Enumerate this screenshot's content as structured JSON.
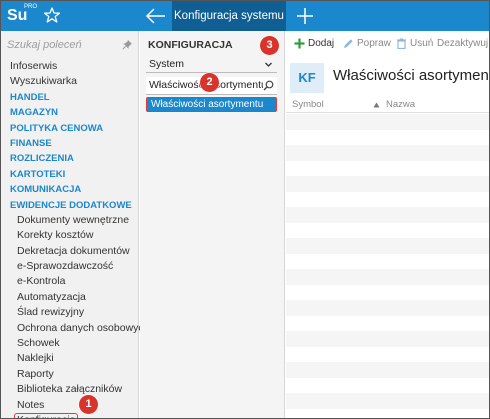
{
  "app": {
    "logo_text": "Su",
    "logo_sup": "PRO",
    "active_tab": "Konfiguracja systemu"
  },
  "sidebar": {
    "search_placeholder": "Szukaj poleceń",
    "items": [
      {
        "label": "Infoserwis",
        "type": "item"
      },
      {
        "label": "Wyszukiwarka",
        "type": "item"
      },
      {
        "label": "HANDEL",
        "type": "category"
      },
      {
        "label": "MAGAZYN",
        "type": "category"
      },
      {
        "label": "POLITYKA CENOWA",
        "type": "category"
      },
      {
        "label": "FINANSE",
        "type": "category"
      },
      {
        "label": "ROZLICZENIA",
        "type": "category"
      },
      {
        "label": "KARTOTEKI",
        "type": "category"
      },
      {
        "label": "KOMUNIKACJA",
        "type": "category"
      },
      {
        "label": "EWIDENCJE DODATKOWE",
        "type": "category"
      },
      {
        "label": "Dokumenty wewnętrzne",
        "type": "sub"
      },
      {
        "label": "Korekty kosztów",
        "type": "sub"
      },
      {
        "label": "Dekretacja dokumentów",
        "type": "sub"
      },
      {
        "label": "e-Sprawozdawczość",
        "type": "sub"
      },
      {
        "label": "e-Kontrola",
        "type": "sub"
      },
      {
        "label": "Automatyzacja",
        "type": "sub"
      },
      {
        "label": "Ślad rewizyjny",
        "type": "sub"
      },
      {
        "label": "Ochrona danych osobowych",
        "type": "sub"
      },
      {
        "label": "Schowek",
        "type": "sub"
      },
      {
        "label": "Naklejki",
        "type": "sub"
      },
      {
        "label": "Raporty",
        "type": "sub"
      },
      {
        "label": "Biblioteka załączników",
        "type": "sub"
      },
      {
        "label": "Notes",
        "type": "sub"
      },
      {
        "label": "Konfiguracja",
        "type": "sub-selected"
      }
    ]
  },
  "config_panel": {
    "title": "KONFIGURACJA",
    "select_value": "System",
    "search_value": "Właściwości asortymentu",
    "tree_selected": "Właściwości asortymentu"
  },
  "badges": {
    "b1": "1",
    "b2": "2",
    "b3": "3"
  },
  "toolbar": {
    "add": "Dodaj",
    "edit": "Popraw",
    "delete": "Usuń",
    "deactivate": "Dezaktywuj"
  },
  "content": {
    "avatar": "KF",
    "title": "Właściwości asortymentu",
    "columns": [
      "Symbol",
      "Nazwa"
    ],
    "empty_rows": 19
  },
  "colors": {
    "accent": "#1b87cc",
    "tab_active": "#0f5f94",
    "badge": "#d9342b",
    "add_icon": "#2e9b3a"
  }
}
